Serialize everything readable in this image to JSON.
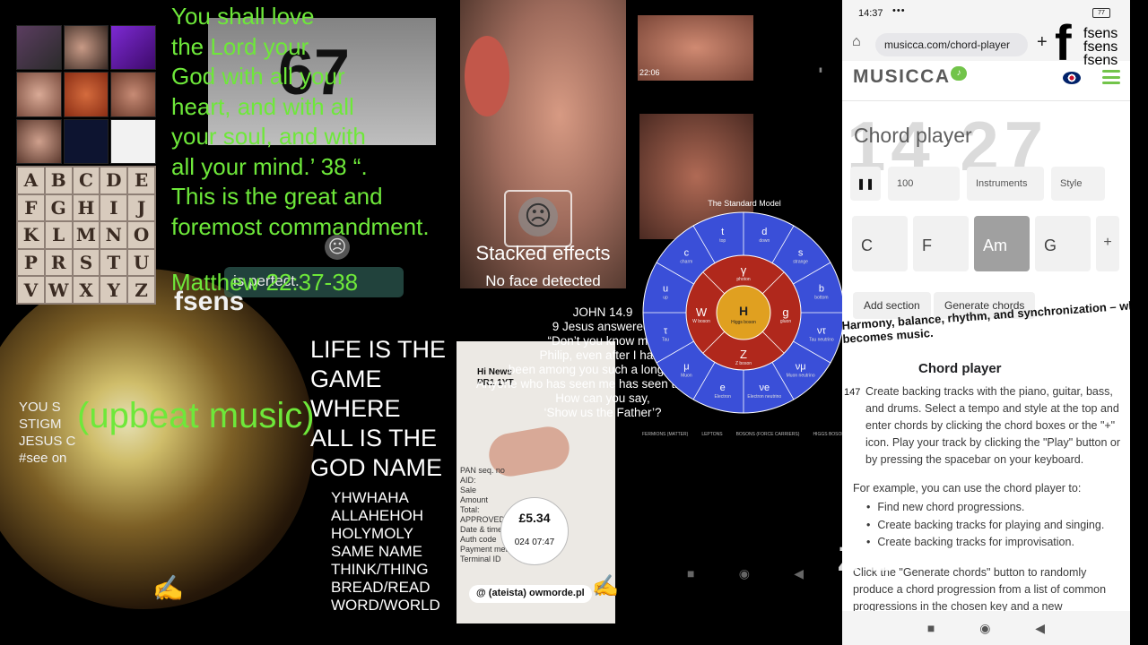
{
  "left_collage": {
    "alphabet": [
      "A",
      "B",
      "C",
      "D",
      "E",
      "F",
      "G",
      "H",
      "I",
      "J",
      "K",
      "L",
      "M",
      "N",
      "O",
      "P",
      "R",
      "S",
      "T",
      "U",
      "V",
      "W",
      "X",
      "Y",
      "Z"
    ]
  },
  "verse": {
    "lines": [
      "You shall love",
      "the Lord your",
      "God with all your",
      "heart, and with all",
      "your soul, and with",
      "all your mind.’ 38 “.",
      "This is the great and",
      "foremost commandment."
    ],
    "citation": "Matthew 22:37-38",
    "overlay": "is perfect.",
    "book_number": "67"
  },
  "captions": {
    "upbeat": "(upbeat music)",
    "left_note": [
      "YOU S",
      "STIGM",
      "JESUS C",
      "#see on"
    ],
    "watermark": "fsens"
  },
  "life_game": [
    "LIFE IS THE",
    "GAME",
    "WHERE",
    "ALL IS THE",
    "GOD NAME"
  ],
  "names": [
    "YHWHAHA",
    "ALLAHEHOH",
    "HOLYMOLY",
    "SAME  NAME",
    "THINK/THING",
    "BREAD/READ",
    "WORD/WORLD"
  ],
  "face_filter": {
    "title": "Stacked effects",
    "status": "No face detected"
  },
  "john": {
    "lines": [
      "JOHN 14.9",
      "9 Jesus answered:",
      "“Don’t you know me,",
      "Philip, even after I have",
      "been among you such a long time?",
      "Anyone who has seen me has seen the Father.",
      "How can you say,",
      "‘Show us the Father’?"
    ]
  },
  "receipt": {
    "header": [
      "Hi News",
      "PR1 1YT"
    ],
    "side": [
      "PAN seq. no",
      "AID:",
      "Sale",
      "Amount",
      "Total:",
      "APPROVED",
      "Date & time",
      "Auth code",
      "Payment method",
      "Terminal ID"
    ],
    "amount": "£5.34",
    "time": "024 07:47",
    "tag": "@ (ateista) owmorde.pl"
  },
  "video_timestamp": "22:06",
  "standard_model": {
    "title": "The Standard Model",
    "center": {
      "symbol": "H",
      "name": "Higgs boson"
    },
    "bosons": [
      {
        "symbol": "γ",
        "name": "photon"
      },
      {
        "symbol": "g",
        "name": "gluon"
      },
      {
        "symbol": "Z",
        "name": "Z boson"
      },
      {
        "symbol": "W",
        "name": "W boson"
      }
    ],
    "fermions": [
      {
        "symbol": "d",
        "name": "down"
      },
      {
        "symbol": "s",
        "name": "strange"
      },
      {
        "symbol": "b",
        "name": "bottom"
      },
      {
        "symbol": "ντ",
        "name": "Tau neutrino"
      },
      {
        "symbol": "νμ",
        "name": "Muon neutrino"
      },
      {
        "symbol": "νe",
        "name": "Electron neutrino"
      },
      {
        "symbol": "e",
        "name": "Electron"
      },
      {
        "symbol": "μ",
        "name": "Muon"
      },
      {
        "symbol": "τ",
        "name": "Tau"
      },
      {
        "symbol": "u",
        "name": "up"
      },
      {
        "symbol": "c",
        "name": "charm"
      },
      {
        "symbol": "t",
        "name": "top"
      }
    ],
    "legend": [
      "FERMIONS (MATTER)",
      "LEPTONS",
      "BOSONS (FORCE CARRIERS)",
      "HIGGS BOSON"
    ],
    "colors": {
      "quark": "#c8281e",
      "lepton": "#3a4fd8",
      "boson": "#b0281c",
      "higgs": "#e0a020"
    }
  },
  "phone": {
    "time": "14:37",
    "dots": "•••",
    "battery": "77",
    "url": "musicca.com/chord-player",
    "brand": "MUSICCA",
    "overlay_digits": "14 27",
    "page_title": "Chord player",
    "controls": {
      "play": "❚❚",
      "tempo": "100",
      "instrument": "Instruments",
      "style": "Style"
    },
    "chords": [
      "C",
      "F",
      "Am",
      "G"
    ],
    "active_chord": "Am",
    "add_chord": "+",
    "buttons": {
      "add_section": "Add section",
      "generate": "Generate chords"
    },
    "slanted": [
      "Harmony, balance, rhythm, and synchronization – where light",
      "becomes music."
    ],
    "section_title": "Chord player",
    "number": "147",
    "intro": "Create backing tracks with the piano, guitar, bass, and drums. Select a tempo and style at the top and enter chords by clicking the chord boxes or the \"+\" icon. Play your track by clicking the \"Play\" button or by pressing the spacebar on your keyboard.",
    "example_lead": "For example, you can use the chord player to:",
    "uses": [
      "Find new chord progressions.",
      "Create backing tracks for playing and singing.",
      "Create backing tracks for improvisation."
    ],
    "generate_text": "Click the \"Generate chords\" button to randomly produce a chord progression from a list of common progressions in the chosen key and a new",
    "nav": [
      "■",
      "◉",
      "◀"
    ],
    "accent": "#72c44a"
  }
}
